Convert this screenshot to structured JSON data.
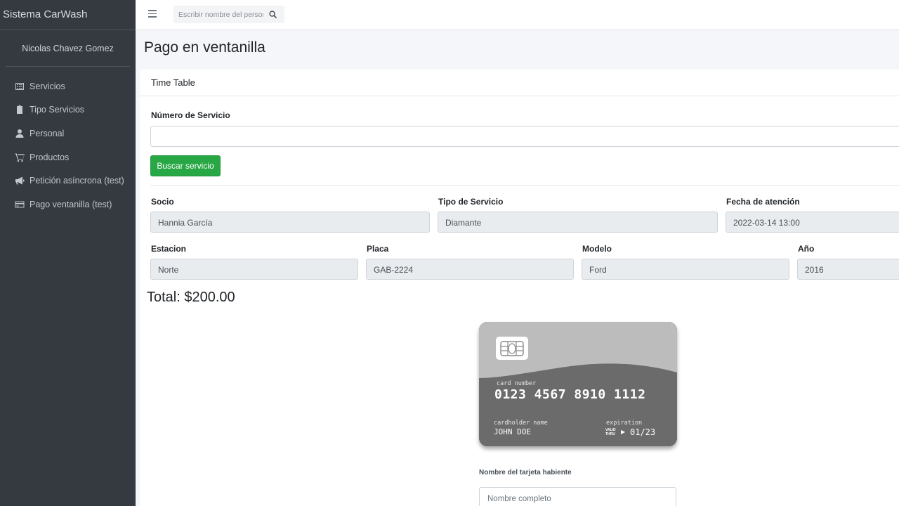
{
  "app": {
    "brand": "Sistema CarWash",
    "user_name": "Nicolas Chavez Gomez"
  },
  "sidebar": {
    "items": [
      {
        "label": "Servicios",
        "icon": "list-alt-icon"
      },
      {
        "label": "Tipo Servicios",
        "icon": "clipboard-icon"
      },
      {
        "label": "Personal",
        "icon": "user-icon"
      },
      {
        "label": "Productos",
        "icon": "cart-icon"
      },
      {
        "label": "Petición asíncrona (test)",
        "icon": "bullhorn-icon"
      },
      {
        "label": "Pago ventanilla (test)",
        "icon": "credit-card-icon"
      }
    ]
  },
  "topbar": {
    "search_placeholder": "Escribir nombre del personal"
  },
  "page": {
    "title": "Pago en ventanilla"
  },
  "card": {
    "header": "Time Table"
  },
  "form": {
    "service_number_label": "Número de Servicio",
    "service_number_value": "",
    "search_button": "Buscar servicio",
    "socio_label": "Socio",
    "socio_value": "Hannia García",
    "tipo_label": "Tipo de Servicio",
    "tipo_value": "Diamante",
    "fecha_label": "Fecha de atención",
    "fecha_value": "2022-03-14 13:00",
    "estacion_label": "Estacion",
    "estacion_value": "Norte",
    "placa_label": "Placa",
    "placa_value": "GAB-2224",
    "modelo_label": "Modelo",
    "modelo_value": "Ford",
    "anio_label": "Año",
    "anio_value": "2016",
    "total": "Total: $200.00"
  },
  "credit_card": {
    "number_label": "card number",
    "number": "0123 4567 8910 1112",
    "holder_label": "cardholder name",
    "holder": "JOHN DOE",
    "expiration_label": "expiration",
    "valid_thru_line1": "VALID",
    "valid_thru_line2": "THRU",
    "expiration": "01/23"
  },
  "payment": {
    "holder_label": "Nombre del tarjeta habiente",
    "holder_placeholder": "Nombre completo"
  },
  "colors": {
    "sidebar_bg": "#343a40",
    "success": "#28a745",
    "readonly_bg": "#e9ecef",
    "card_light": "#bdbdbd",
    "card_dark": "#6b6b6b"
  }
}
